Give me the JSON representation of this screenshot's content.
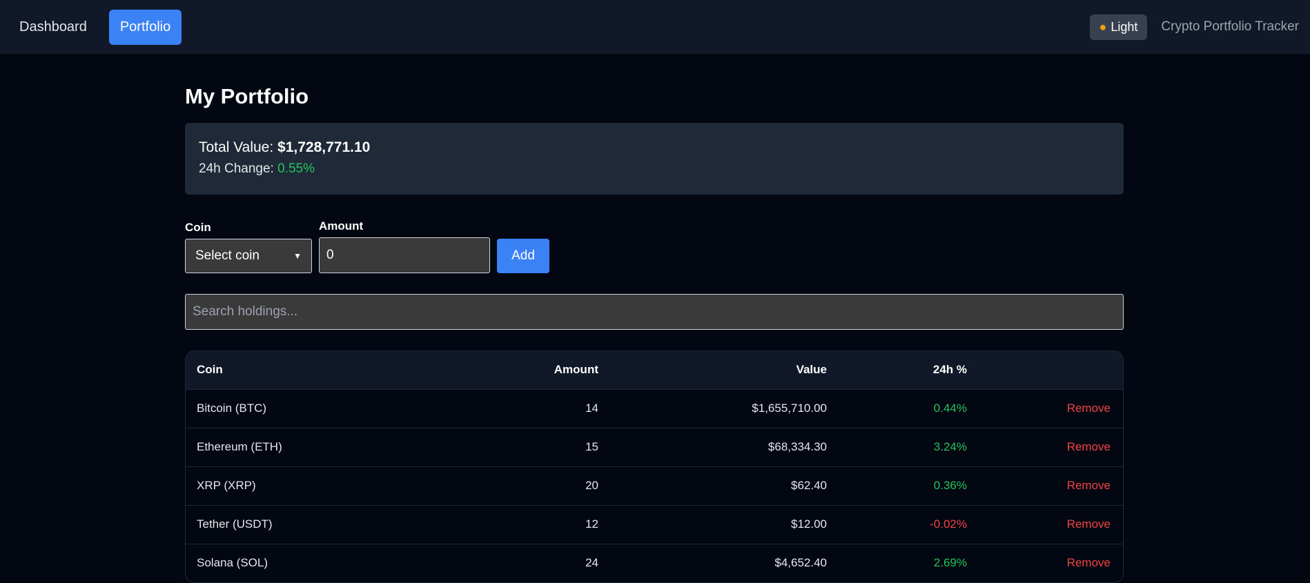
{
  "nav": {
    "items": [
      {
        "label": "Dashboard",
        "active": false
      },
      {
        "label": "Portfolio",
        "active": true
      }
    ]
  },
  "theme_toggle": {
    "label": "Light",
    "icon": "sun-icon"
  },
  "brand": {
    "title": "Crypto Portfolio Tracker"
  },
  "page": {
    "title": "My Portfolio"
  },
  "summary": {
    "total_label": "Total Value:",
    "total_value": "$1,728,771.10",
    "change_label": "24h Change:",
    "change_value": "0.55%"
  },
  "form": {
    "coin_label": "Coin",
    "coin_selected": "Select coin",
    "amount_label": "Amount",
    "amount_value": "0",
    "add_label": "Add"
  },
  "search": {
    "placeholder": "Search holdings..."
  },
  "table": {
    "headers": {
      "coin": "Coin",
      "amount": "Amount",
      "value": "Value",
      "change": "24h %"
    },
    "rows": [
      {
        "coin": "Bitcoin (BTC)",
        "amount": "14",
        "value": "$1,655,710.00",
        "change": "0.44%",
        "direction": "up",
        "action": "Remove"
      },
      {
        "coin": "Ethereum (ETH)",
        "amount": "15",
        "value": "$68,334.30",
        "change": "3.24%",
        "direction": "up",
        "action": "Remove"
      },
      {
        "coin": "XRP (XRP)",
        "amount": "20",
        "value": "$62.40",
        "change": "0.36%",
        "direction": "up",
        "action": "Remove"
      },
      {
        "coin": "Tether (USDT)",
        "amount": "12",
        "value": "$12.00",
        "change": "-0.02%",
        "direction": "down",
        "action": "Remove"
      },
      {
        "coin": "Solana (SOL)",
        "amount": "24",
        "value": "$4,652.40",
        "change": "2.69%",
        "direction": "up",
        "action": "Remove"
      }
    ]
  },
  "colors": {
    "accent": "#3b82f6",
    "positive": "#22c55e",
    "negative": "#ef4444",
    "background": "#030712",
    "panel": "#1f2937"
  }
}
